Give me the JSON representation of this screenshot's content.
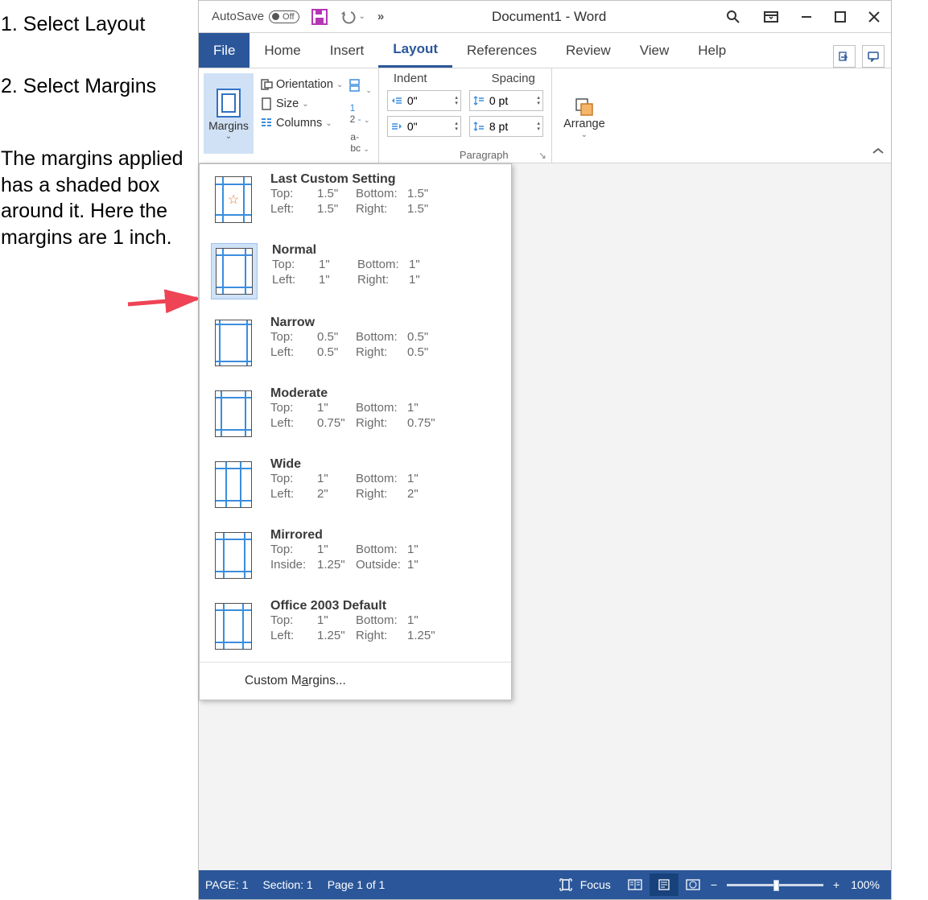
{
  "instructions": {
    "step1": "1. Select Layout",
    "step2": "2. Select Margins",
    "explanation": "The margins applied has a shaded box around it. Here the margins are 1 inch."
  },
  "titlebar": {
    "autosave_label": "AutoSave",
    "autosave_state": "Off",
    "document_title": "Document1  -  Word"
  },
  "tabs": {
    "file": "File",
    "home": "Home",
    "insert": "Insert",
    "layout": "Layout",
    "references": "References",
    "review": "Review",
    "view": "View",
    "help": "Help"
  },
  "ribbon": {
    "margins_label": "Margins",
    "orientation_label": "Orientation",
    "size_label": "Size",
    "columns_label": "Columns",
    "indent_label": "Indent",
    "spacing_label": "Spacing",
    "indent_left": "0\"",
    "indent_right": "0\"",
    "spacing_before": "0 pt",
    "spacing_after": "8 pt",
    "paragraph_group": "Paragraph",
    "arrange_label": "Arrange"
  },
  "margins_menu": {
    "options": [
      {
        "title": "Last Custom Setting",
        "k1": "Top:",
        "v1": "1.5\"",
        "k2": "Bottom:",
        "v2": "1.5\"",
        "k3": "Left:",
        "v3": "1.5\"",
        "k4": "Right:",
        "v4": "1.5\"",
        "selected": false,
        "star": true,
        "m": [
          8,
          8,
          8,
          8
        ]
      },
      {
        "title": "Normal",
        "k1": "Top:",
        "v1": "1\"",
        "k2": "Bottom:",
        "v2": "1\"",
        "k3": "Left:",
        "v3": "1\"",
        "k4": "Right:",
        "v4": "1\"",
        "selected": true,
        "star": false,
        "m": [
          7,
          7,
          7,
          7
        ]
      },
      {
        "title": "Narrow",
        "k1": "Top:",
        "v1": "0.5\"",
        "k2": "Bottom:",
        "v2": "0.5\"",
        "k3": "Left:",
        "v3": "0.5\"",
        "k4": "Right:",
        "v4": "0.5\"",
        "selected": false,
        "star": false,
        "m": [
          4,
          4,
          4,
          4
        ]
      },
      {
        "title": "Moderate",
        "k1": "Top:",
        "v1": "1\"",
        "k2": "Bottom:",
        "v2": "1\"",
        "k3": "Left:",
        "v3": "0.75\"",
        "k4": "Right:",
        "v4": "0.75\"",
        "selected": false,
        "star": false,
        "m": [
          6,
          6,
          7,
          7
        ]
      },
      {
        "title": "Wide",
        "k1": "Top:",
        "v1": "1\"",
        "k2": "Bottom:",
        "v2": "1\"",
        "k3": "Left:",
        "v3": "2\"",
        "k4": "Right:",
        "v4": "2\"",
        "selected": false,
        "star": false,
        "m": [
          12,
          12,
          7,
          7
        ]
      },
      {
        "title": "Mirrored",
        "k1": "Top:",
        "v1": "1\"",
        "k2": "Bottom:",
        "v2": "1\"",
        "k3": "Inside:",
        "v3": "1.25\"",
        "k4": "Outside:",
        "v4": "1\"",
        "selected": false,
        "star": false,
        "m": [
          9,
          7,
          7,
          7
        ]
      },
      {
        "title": "Office 2003 Default",
        "k1": "Top:",
        "v1": "1\"",
        "k2": "Bottom:",
        "v2": "1\"",
        "k3": "Left:",
        "v3": "1.25\"",
        "k4": "Right:",
        "v4": "1.25\"",
        "selected": false,
        "star": false,
        "m": [
          9,
          9,
          7,
          7
        ]
      }
    ],
    "custom_prefix": "Custom M",
    "custom_underline": "a",
    "custom_suffix": "rgins..."
  },
  "status": {
    "page": "PAGE: 1",
    "section": "Section: 1",
    "pageof": "Page 1 of 1",
    "focus": "Focus",
    "zoom": "100%"
  }
}
